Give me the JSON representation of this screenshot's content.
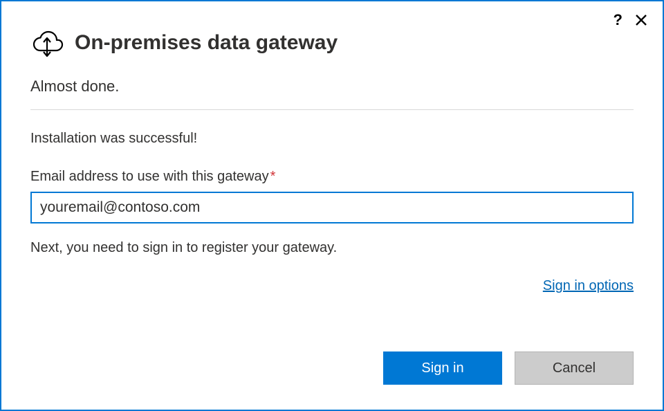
{
  "titlebar": {
    "help_glyph": "?",
    "close_label": "Close"
  },
  "header": {
    "title": "On-premises data gateway",
    "subtitle": "Almost done."
  },
  "body": {
    "status": "Installation was successful!",
    "email_label": "Email address to use with this gateway",
    "required_mark": "*",
    "email_value": "youremail@contoso.com",
    "next_instruction": "Next, you need to sign in to register your gateway.",
    "sign_in_options": "Sign in options"
  },
  "buttons": {
    "primary": "Sign in",
    "secondary": "Cancel"
  }
}
